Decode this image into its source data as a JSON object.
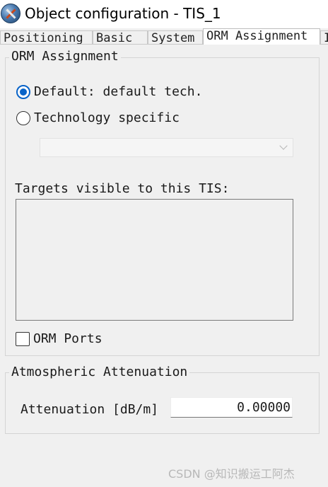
{
  "window": {
    "title": "Object configuration - TIS_1"
  },
  "tabs": [
    {
      "label": "Positioning",
      "active": false
    },
    {
      "label": "Basic",
      "active": false
    },
    {
      "label": "System",
      "active": false
    },
    {
      "label": "ORM Assignment",
      "active": true
    },
    {
      "label": "I",
      "active": false
    }
  ],
  "orm_group": {
    "legend": "ORM Assignment",
    "radio_default": {
      "label": "Default: default tech.",
      "checked": true
    },
    "radio_specific": {
      "label": "Technology specific",
      "checked": false
    },
    "technology_select": {
      "value": ""
    },
    "targets_label": "Targets visible to this TIS:",
    "targets_items": [],
    "orm_ports": {
      "label": "ORM Ports",
      "checked": false
    }
  },
  "atmo_group": {
    "legend": "Atmospheric Attenuation",
    "attenuation_label": "Attenuation [dB/m]",
    "attenuation_value": "0.00000"
  },
  "watermark": "CSDN @知识搬运工阿杰",
  "colors": {
    "accent": "#0a64c8",
    "background": "#f0f0f0"
  }
}
